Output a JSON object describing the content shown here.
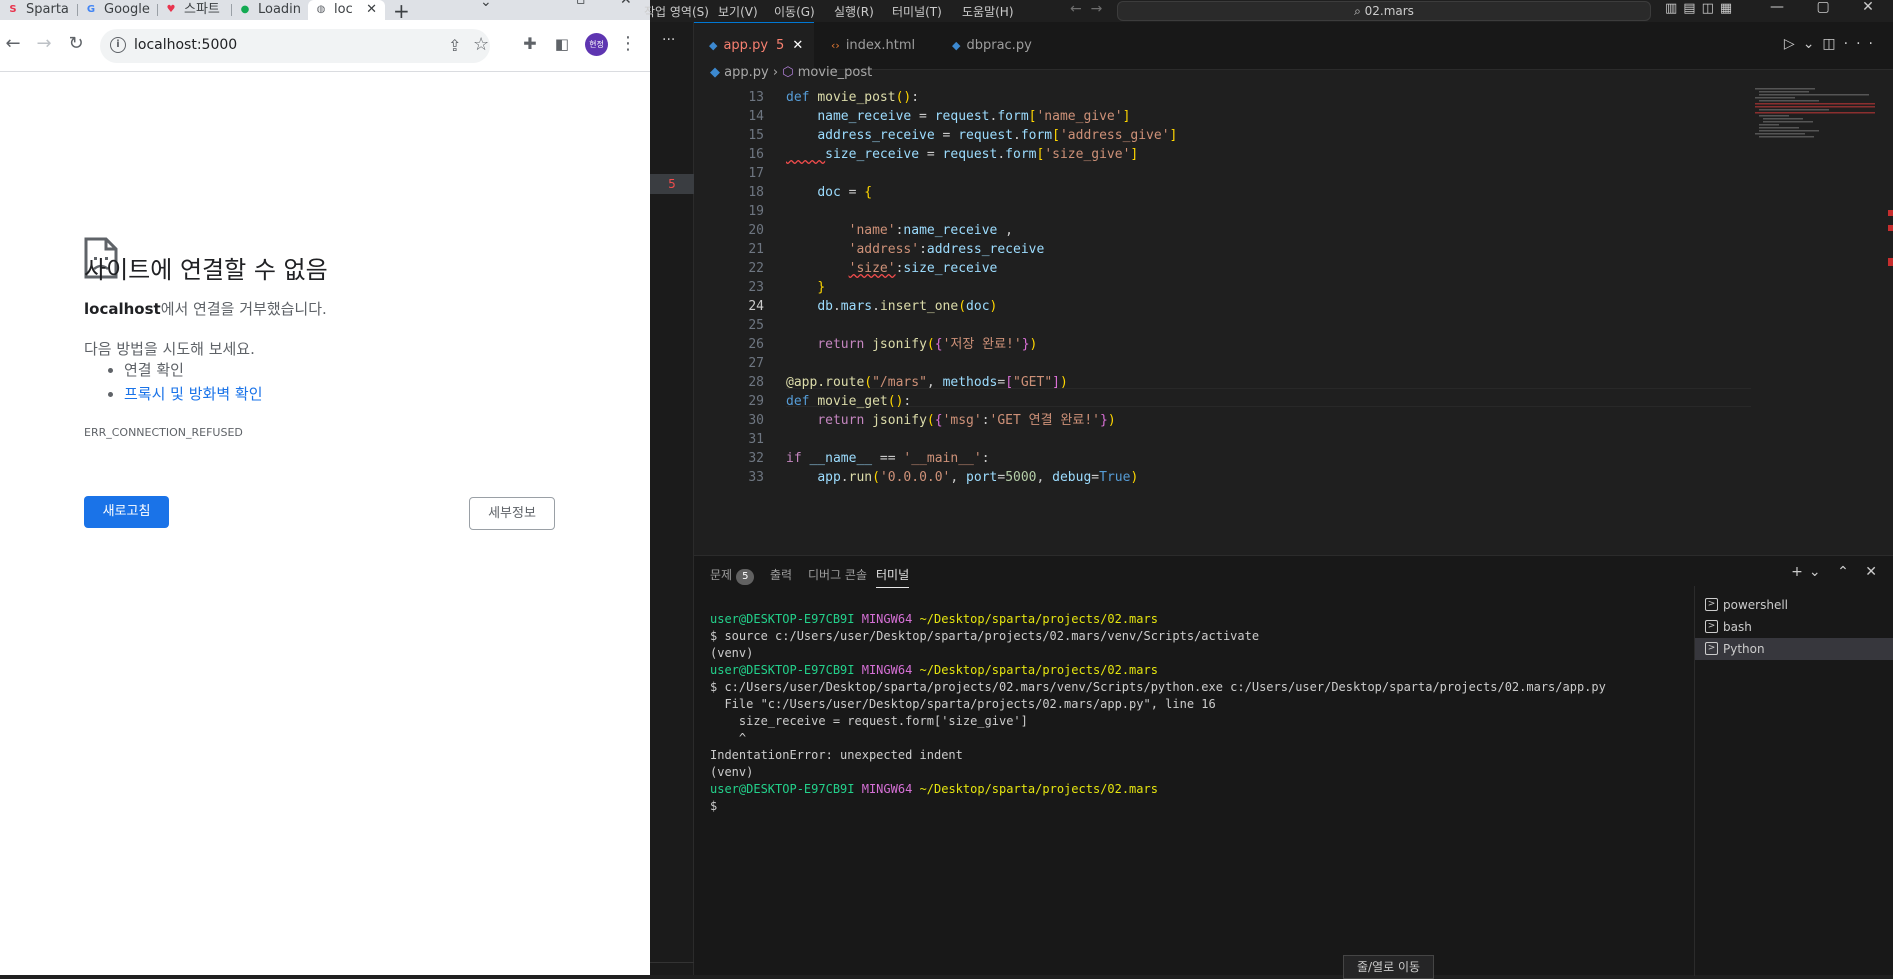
{
  "browser": {
    "tabs": [
      {
        "title": "Sparta",
        "favicon": "S",
        "favicon_color": "#e8344e"
      },
      {
        "title": "Google",
        "favicon": "G",
        "favicon_color": "#4285f4"
      },
      {
        "title": "스파트",
        "favicon": "♥",
        "favicon_color": "#e8344e"
      },
      {
        "title": "Loadin",
        "favicon": "●",
        "favicon_color": "#13aa52"
      },
      {
        "title": "loc",
        "favicon": "◍",
        "favicon_color": "#5f6368"
      }
    ],
    "new_tab": "+",
    "url": "localhost:5000",
    "avatar": "현정",
    "error": {
      "title": "사이트에 연결할 수 없음",
      "host": "localhost",
      "desc_suffix": "에서 연결을 거부했습니다.",
      "try_label": "다음 방법을 시도해 보세요.",
      "suggestions": [
        "연결 확인",
        "프록시 및 방화벽 확인"
      ],
      "code": "ERR_CONNECTION_REFUSED",
      "reload_label": "새로고침",
      "details_label": "세부정보"
    }
  },
  "vscode": {
    "menus": [
      "작업 영역(S)",
      "보기(V)",
      "이동(G)",
      "실행(R)",
      "터미널(T)",
      "도움말(H)"
    ],
    "search_text": "02.mars",
    "activity_badge": "5",
    "tabs": [
      {
        "name": "app.py",
        "icon": "py",
        "badge": "5",
        "active": true
      },
      {
        "name": "index.html",
        "icon": "html",
        "active": false
      },
      {
        "name": "dbprac.py",
        "icon": "py",
        "active": false
      }
    ],
    "breadcrumb": {
      "file": "app.py",
      "symbol": "movie_post"
    },
    "line_numbers": [
      "13",
      "14",
      "15",
      "16",
      "17",
      "18",
      "19",
      "20",
      "21",
      "22",
      "23",
      "24",
      "25",
      "26",
      "27",
      "28",
      "29",
      "30",
      "31",
      "32",
      "33"
    ],
    "panel": {
      "tabs": [
        "문제",
        "출력",
        "디버그 콘솔",
        "터미널"
      ],
      "problems_count": "5",
      "terminals": [
        "powershell",
        "bash",
        "Python"
      ]
    },
    "terminal": {
      "user": "user@DESKTOP-E97CB9I",
      "host": "MINGW64",
      "path": "~/Desktop/sparta/projects/02.mars",
      "line_source": "$ source c:/Users/user/Desktop/sparta/projects/02.mars/venv/Scripts/activate",
      "line_venv": "(venv)",
      "line_run": "$ c:/Users/user/Desktop/sparta/projects/02.mars/venv/Scripts/python.exe c:/Users/user/Desktop/sparta/projects/02.mars/app.py",
      "line_file": "  File \"c:/Users/user/Desktop/sparta/projects/02.mars/app.py\", line 16",
      "line_code": "    size_receive = request.form['size_give']",
      "line_caret": "    ^",
      "line_error": "IndentationError: unexpected indent",
      "line_prompt": "$"
    },
    "goto_tip": "줄/열로 이동"
  }
}
